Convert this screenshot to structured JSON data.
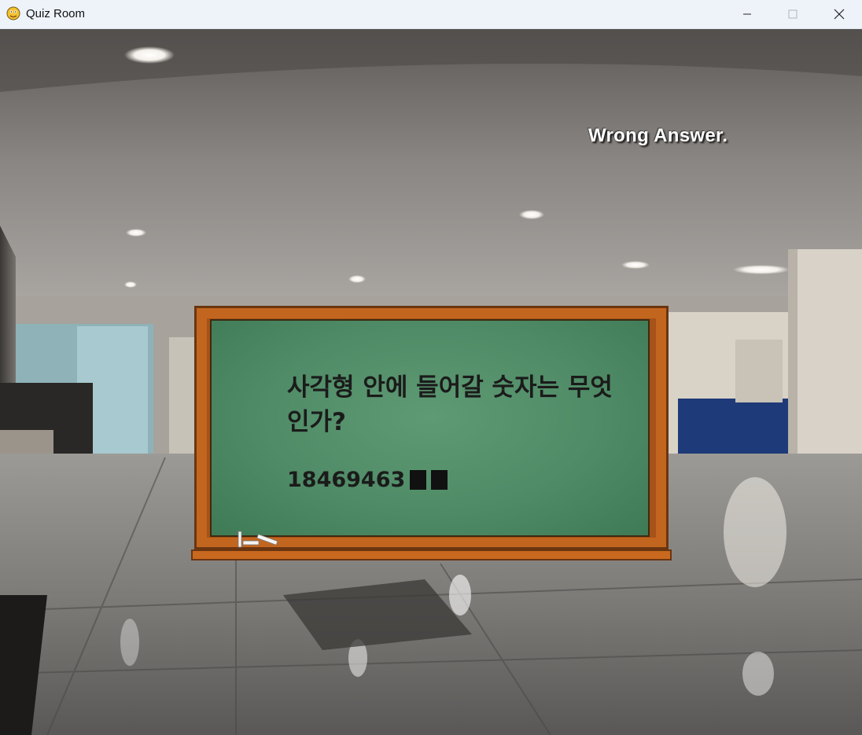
{
  "window": {
    "title": "Quiz Room",
    "minimize_icon": "minimize-icon",
    "maximize_icon": "maximize-icon",
    "close_icon": "close-icon"
  },
  "game": {
    "feedback": "Wrong Answer.",
    "question": "사각형 안에 들어갈 숫자는 무엇인가?",
    "sequence_prefix": "18469463",
    "blank_count": 2
  },
  "colors": {
    "board_green": "#4f8b66",
    "frame_wood": "#c2661f",
    "feedback_text": "#ffffff"
  }
}
